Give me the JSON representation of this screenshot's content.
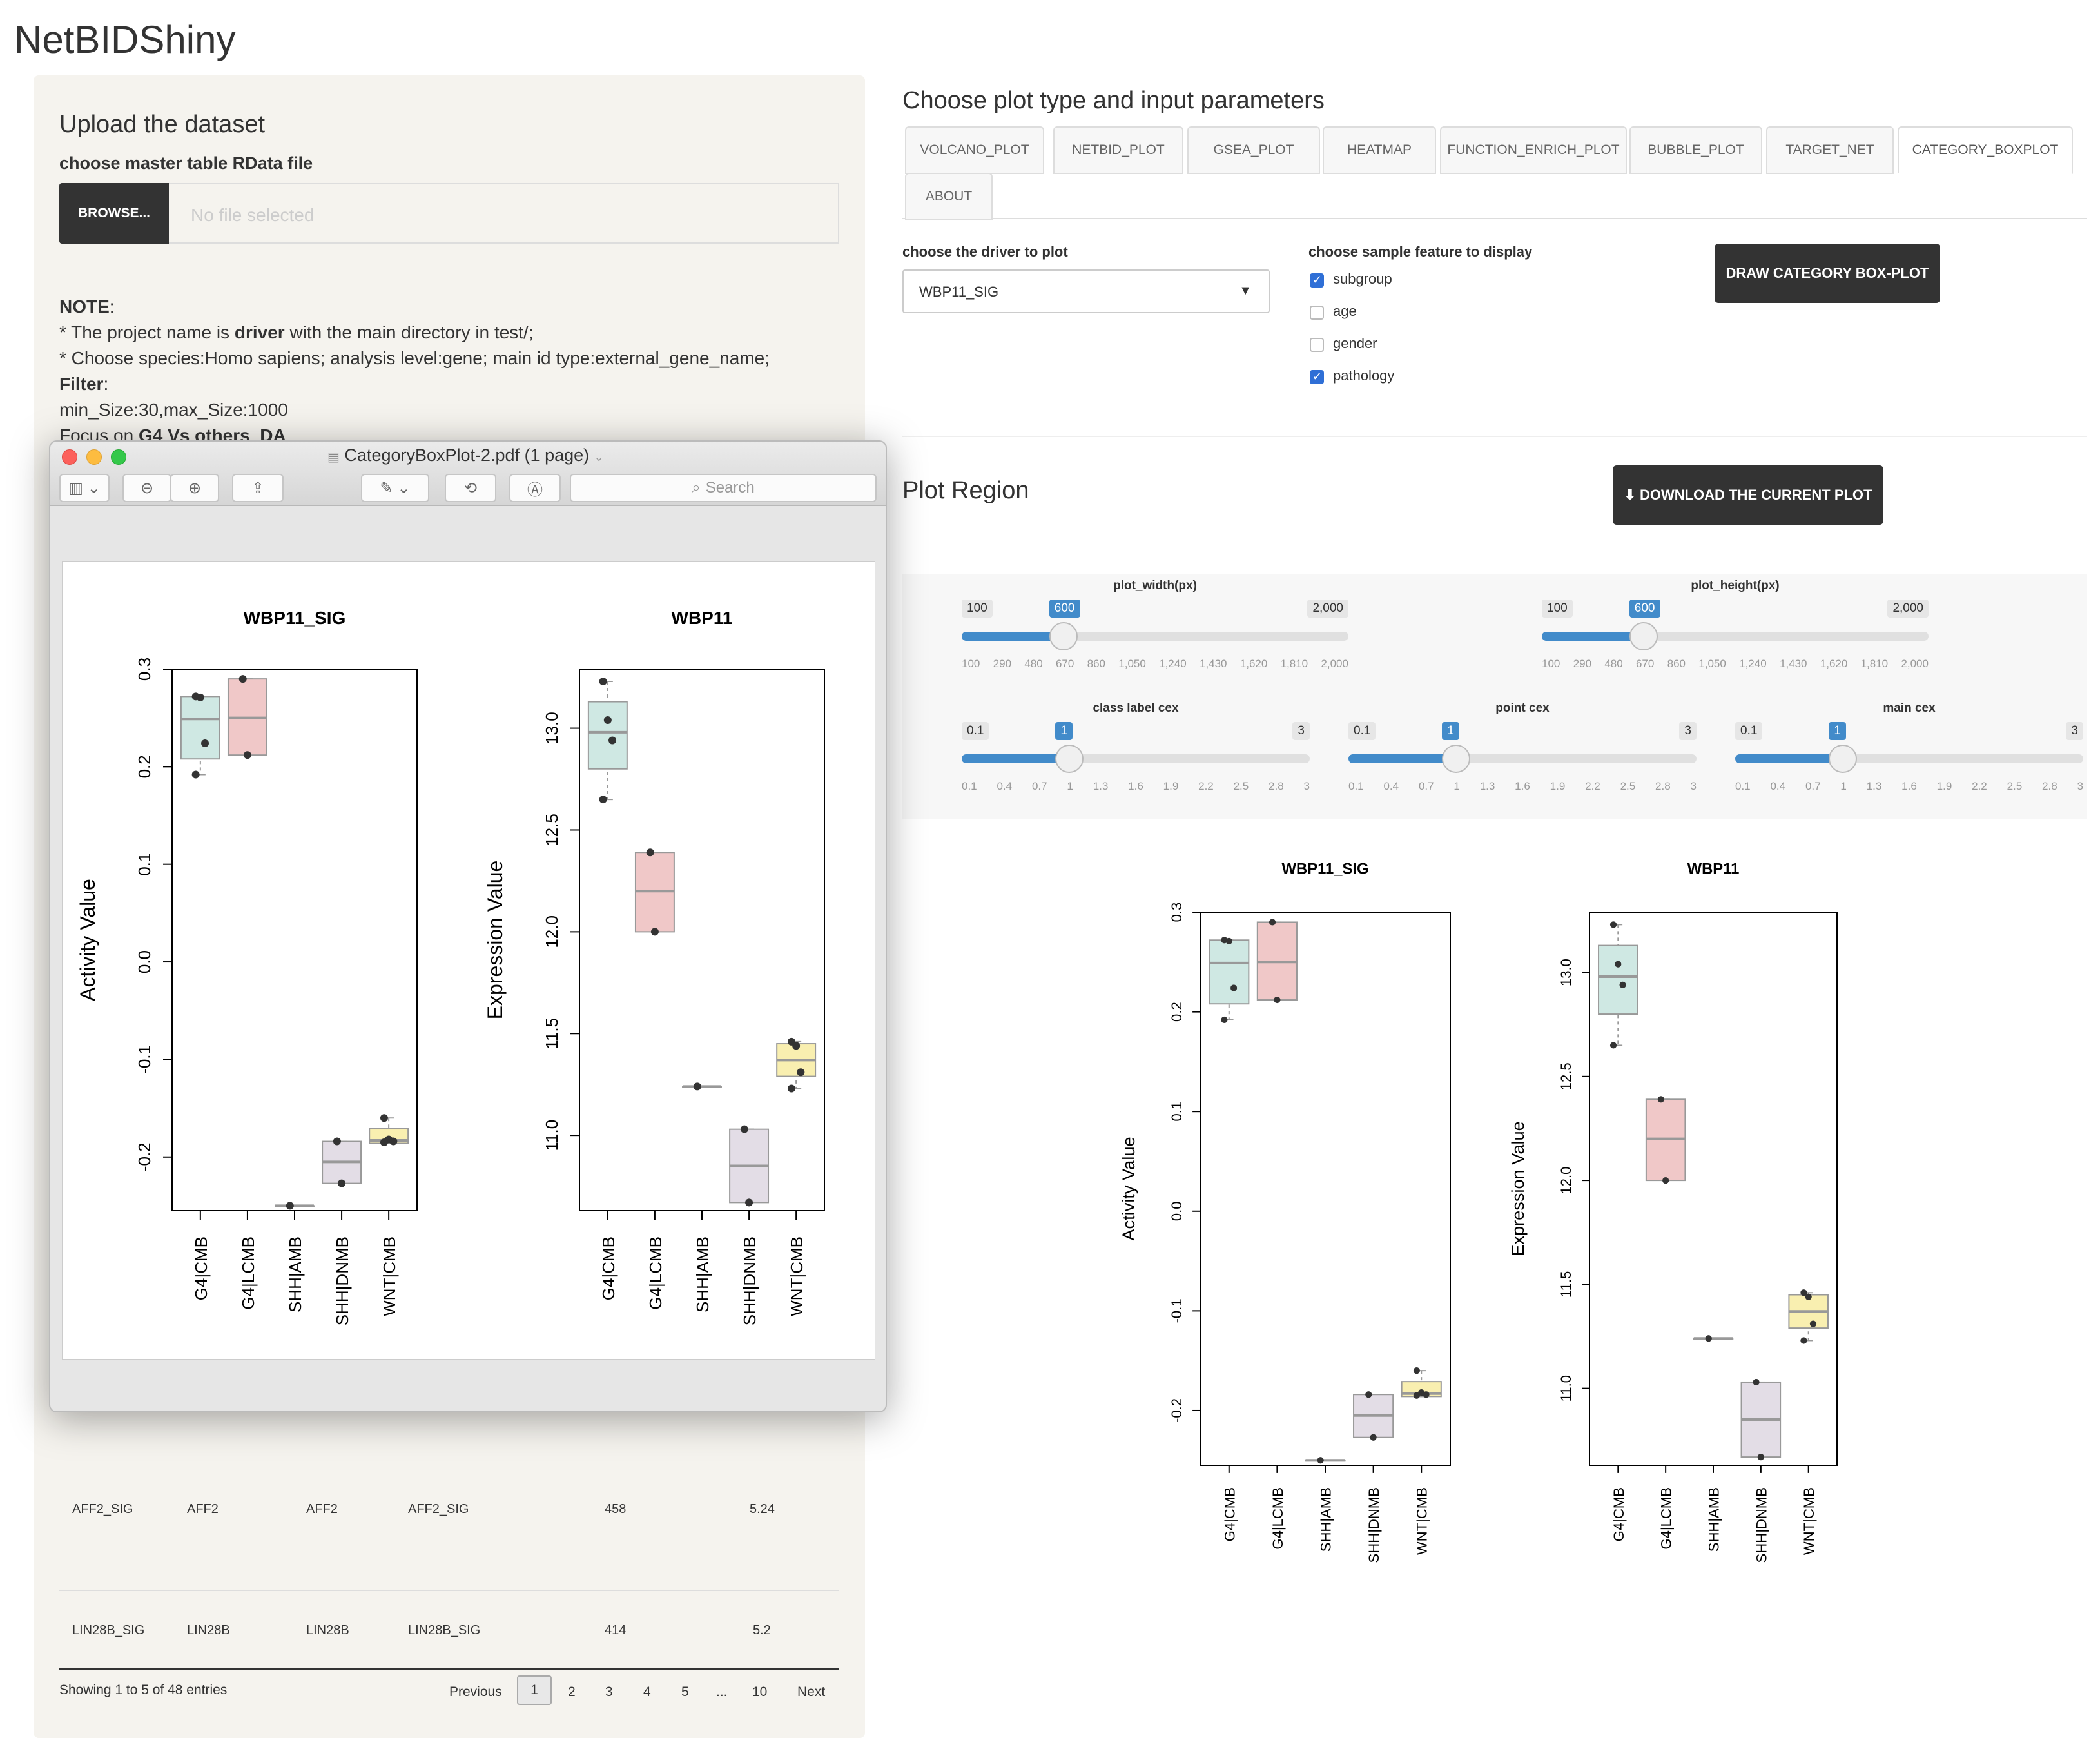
{
  "app_title": "NetBIDShiny",
  "upload": {
    "title": "Upload the dataset",
    "file_label": "choose master table RData file",
    "browse_label": "BROWSE...",
    "file_placeholder": "No file selected"
  },
  "note": {
    "heading": "NOTE",
    "line1_pre": "* The project name is ",
    "line1_bold": "driver",
    "line1_post": " with the main directory in test/;",
    "line2": "* Choose species:Homo sapiens; analysis level:gene; main id type:external_gene_name;",
    "filter_heading": "Filter",
    "filter_value": "min_Size:30,max_Size:1000",
    "focus_pre": "Focus on ",
    "focus_bold": "G4 Vs others_DA"
  },
  "table": {
    "rows": [
      {
        "c1": "AFF2_SIG",
        "c2": "AFF2",
        "c3": "AFF2",
        "c4": "AFF2_SIG",
        "c5": "458",
        "c6": "5.24"
      },
      {
        "c1": "LIN28B_SIG",
        "c2": "LIN28B",
        "c3": "LIN28B",
        "c4": "LIN28B_SIG",
        "c5": "414",
        "c6": "5.2"
      }
    ],
    "info": "Showing 1 to 5 of 48 entries",
    "pagination": {
      "previous": "Previous",
      "pages": [
        "1",
        "2",
        "3",
        "4",
        "5",
        "...",
        "10"
      ],
      "next": "Next"
    }
  },
  "right": {
    "title": "Choose plot type and input parameters",
    "tabs": [
      "VOLCANO_PLOT",
      "NETBID_PLOT",
      "GSEA_PLOT",
      "HEATMAP",
      "FUNCTION_ENRICH_PLOT",
      "BUBBLE_PLOT",
      "TARGET_NET",
      "CATEGORY_BOXPLOT",
      "ABOUT"
    ],
    "active_tab": "CATEGORY_BOXPLOT",
    "driver_label": "choose the driver to plot",
    "driver_value": "WBP11_SIG",
    "feature_label": "choose sample feature to display",
    "features": [
      {
        "label": "subgroup",
        "checked": true
      },
      {
        "label": "age",
        "checked": false
      },
      {
        "label": "gender",
        "checked": false
      },
      {
        "label": "pathology",
        "checked": true
      }
    ],
    "draw_button": "DRAW CATEGORY BOX-PLOT",
    "plot_region_title": "Plot Region",
    "download_button": "DOWNLOAD THE CURRENT PLOT",
    "accent_color": "#428bca"
  },
  "sliders": {
    "plot_width": {
      "title": "plot_width(px)",
      "min": "100",
      "max": "2,000",
      "value": "600",
      "fraction": 0.263,
      "ticks": [
        "100",
        "290",
        "480",
        "670",
        "860",
        "1,050",
        "1,240",
        "1,430",
        "1,620",
        "1,810",
        "2,000"
      ]
    },
    "plot_height": {
      "title": "plot_height(px)",
      "min": "100",
      "max": "2,000",
      "value": "600",
      "fraction": 0.263,
      "ticks": [
        "100",
        "290",
        "480",
        "670",
        "860",
        "1,050",
        "1,240",
        "1,430",
        "1,620",
        "1,810",
        "2,000"
      ]
    },
    "class_label_cex": {
      "title": "class label cex",
      "min": "0.1",
      "max": "3",
      "value": "1",
      "fraction": 0.31,
      "ticks": [
        "0.1",
        "0.4",
        "0.7",
        "1",
        "1.3",
        "1.6",
        "1.9",
        "2.2",
        "2.5",
        "2.8",
        "3"
      ]
    },
    "point_cex": {
      "title": "point cex",
      "min": "0.1",
      "max": "3",
      "value": "1",
      "fraction": 0.31,
      "ticks": [
        "0.1",
        "0.4",
        "0.7",
        "1",
        "1.3",
        "1.6",
        "1.9",
        "2.2",
        "2.5",
        "2.8",
        "3"
      ]
    },
    "main_cex": {
      "title": "main cex",
      "min": "0.1",
      "max": "3",
      "value": "1",
      "fraction": 0.31,
      "ticks": [
        "0.1",
        "0.4",
        "0.7",
        "1",
        "1.3",
        "1.6",
        "1.9",
        "2.2",
        "2.5",
        "2.8",
        "3"
      ]
    }
  },
  "preview": {
    "window_title": "CategoryBoxPlot-2.pdf (1 page)",
    "search_placeholder": "Search"
  },
  "chart_data": [
    {
      "type": "box",
      "title": "WBP11_SIG",
      "ylabel": "Activity Value",
      "ylim": [
        -0.255,
        0.3
      ],
      "yticks": [
        -0.2,
        -0.1,
        0.0,
        0.1,
        0.2,
        0.3
      ],
      "ytick_labels": [
        "-0.2",
        "-0.1",
        "0.0",
        "0.1",
        "0.2",
        "0.3"
      ],
      "categories": [
        "G4|CMB",
        "G4|LCMB",
        "SHH|AMB",
        "SHH|DNMB",
        "WNT|CMB"
      ],
      "colors": [
        "#cfe8e3",
        "#f0c8c8",
        "#dcdcdc",
        "#e3dde6",
        "#f9efb0"
      ],
      "boxes": [
        {
          "q1": 0.208,
          "median": 0.249,
          "q3": 0.272,
          "min": 0.192,
          "max": 0.272,
          "points": [
            0.272,
            0.271,
            0.224,
            0.192
          ]
        },
        {
          "q1": 0.212,
          "median": 0.25,
          "q3": 0.29,
          "min": 0.212,
          "max": 0.29,
          "points": [
            0.29,
            0.212
          ]
        },
        {
          "q1": -0.25,
          "median": -0.25,
          "q3": -0.25,
          "min": -0.25,
          "max": -0.25,
          "points": [
            -0.25
          ]
        },
        {
          "q1": -0.227,
          "median": -0.205,
          "q3": -0.184,
          "min": -0.227,
          "max": -0.184,
          "points": [
            -0.184,
            -0.227
          ]
        },
        {
          "q1": -0.186,
          "median": -0.183,
          "q3": -0.171,
          "min": -0.186,
          "max": -0.16,
          "points": [
            -0.16,
            -0.182,
            -0.184,
            -0.185
          ]
        }
      ]
    },
    {
      "type": "box",
      "title": "WBP11",
      "ylabel": "Expression Value",
      "ylim": [
        10.63,
        13.29
      ],
      "yticks": [
        11.0,
        11.5,
        12.0,
        12.5,
        13.0
      ],
      "ytick_labels": [
        "11.0",
        "11.5",
        "12.0",
        "12.5",
        "13.0"
      ],
      "categories": [
        "G4|CMB",
        "G4|LCMB",
        "SHH|AMB",
        "SHH|DNMB",
        "WNT|CMB"
      ],
      "colors": [
        "#cfe8e3",
        "#f0c8c8",
        "#dcdcdc",
        "#e3dde6",
        "#f9efb0"
      ],
      "boxes": [
        {
          "q1": 12.8,
          "median": 12.98,
          "q3": 13.13,
          "min": 12.65,
          "max": 13.23,
          "points": [
            13.23,
            13.04,
            12.94,
            12.65
          ]
        },
        {
          "q1": 12.0,
          "median": 12.2,
          "q3": 12.39,
          "min": 12.0,
          "max": 12.39,
          "points": [
            12.39,
            12.0
          ]
        },
        {
          "q1": 11.24,
          "median": 11.24,
          "q3": 11.24,
          "min": 11.24,
          "max": 11.24,
          "points": [
            11.24
          ]
        },
        {
          "q1": 10.67,
          "median": 10.85,
          "q3": 11.03,
          "min": 10.67,
          "max": 11.03,
          "points": [
            11.03,
            10.67
          ]
        },
        {
          "q1": 11.29,
          "median": 11.37,
          "q3": 11.45,
          "min": 11.23,
          "max": 11.46,
          "points": [
            11.46,
            11.44,
            11.31,
            11.23
          ]
        }
      ]
    }
  ]
}
